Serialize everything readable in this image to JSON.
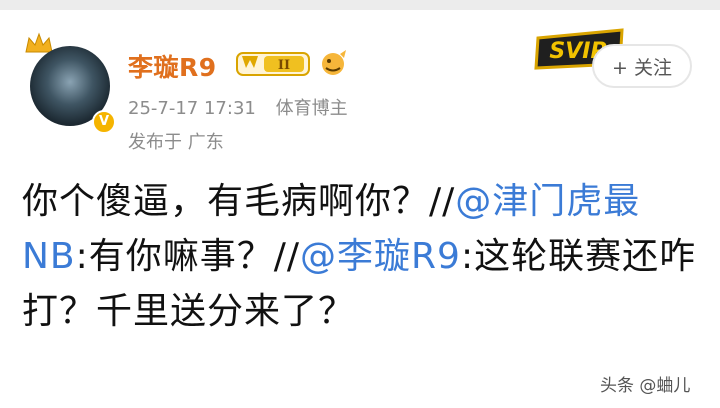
{
  "user": {
    "name": "李璇R9",
    "level_badge": "II",
    "vip_mark": "V"
  },
  "post": {
    "time": "25-7-17 17:31",
    "tag": "体育博主",
    "location": "发布于 广东",
    "segments": [
      {
        "text": "你个傻逼，有毛病啊你？//",
        "type": "text"
      },
      {
        "text": "@津门虎最NB",
        "type": "mention"
      },
      {
        "text": ":有你嘛事？//",
        "type": "text"
      },
      {
        "text": "@李璇R9",
        "type": "mention"
      },
      {
        "text": ":这轮联赛还咋打？千里送分来了？",
        "type": "text"
      }
    ]
  },
  "follow_button": {
    "label": "+ 关注"
  },
  "sv_logo_text": "SVIP",
  "watermark": "头条 @蛐儿",
  "colors": {
    "name": "#e0701e",
    "mention": "#3b7bd6",
    "meta": "#8c8c8c",
    "vip": "#f5b400"
  }
}
